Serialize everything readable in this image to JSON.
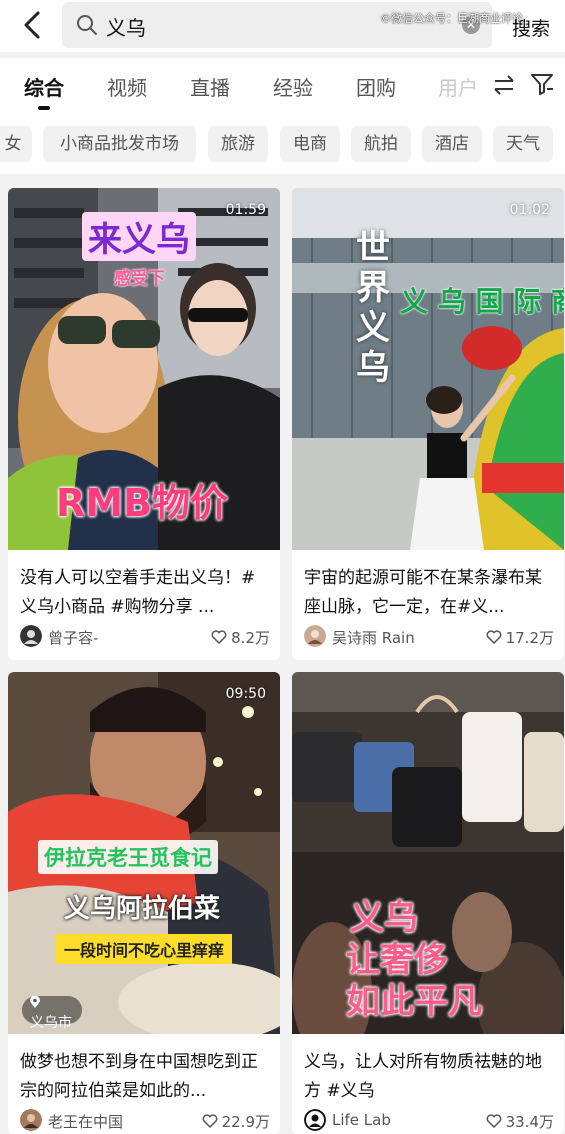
{
  "header": {
    "search_query": "义乌",
    "search_button": "搜索",
    "watermark": "©微信公众号：巨潮商业评论"
  },
  "tabs": [
    "综合",
    "视频",
    "直播",
    "经验",
    "团购",
    "用户"
  ],
  "chips": [
    "女",
    "小商品批发市场",
    "旅游",
    "电商",
    "航拍",
    "酒店",
    "天气"
  ],
  "cards": [
    {
      "duration": "01:59",
      "overlay": [
        "来义乌",
        "感受下",
        "RMB物价"
      ],
      "caption": "没有人可以空着手走出义乌！#义乌小商品 #购物分享 ...",
      "author": "曾子容-",
      "likes": "8.2万"
    },
    {
      "duration": "01:02",
      "overlay": [
        "世界义乌"
      ],
      "caption": "宇宙的起源可能不在某条瀑布某座山脉，它一定，在#义...",
      "author": "吴诗雨 Rain",
      "likes": "17.2万"
    },
    {
      "duration": "09:50",
      "overlay": [
        "伊拉克老王觅食记",
        "义乌阿拉伯菜",
        "一段时间不吃心里痒痒"
      ],
      "location": "义乌市",
      "caption": "做梦也想不到身在中国想吃到正宗的阿拉伯菜是如此的...",
      "author": "老王在中国",
      "likes": "22.9万"
    },
    {
      "duration": "",
      "overlay": [
        "义乌",
        "让奢侈",
        "如此平凡"
      ],
      "caption": "义乌，让人对所有物质祛魅的地方 #义乌",
      "author": "Life Lab",
      "likes": "33.4万"
    }
  ],
  "colors": {
    "accent_dark": "#111111",
    "overlay_pink": "#e8417a",
    "overlay_purple": "#6a2bd6",
    "overlay_green": "#19c05a"
  },
  "icons": [
    "back-arrow-icon",
    "search-icon",
    "clear-icon",
    "swap-icon",
    "filter-icon",
    "heart-icon",
    "location-pin-icon"
  ]
}
